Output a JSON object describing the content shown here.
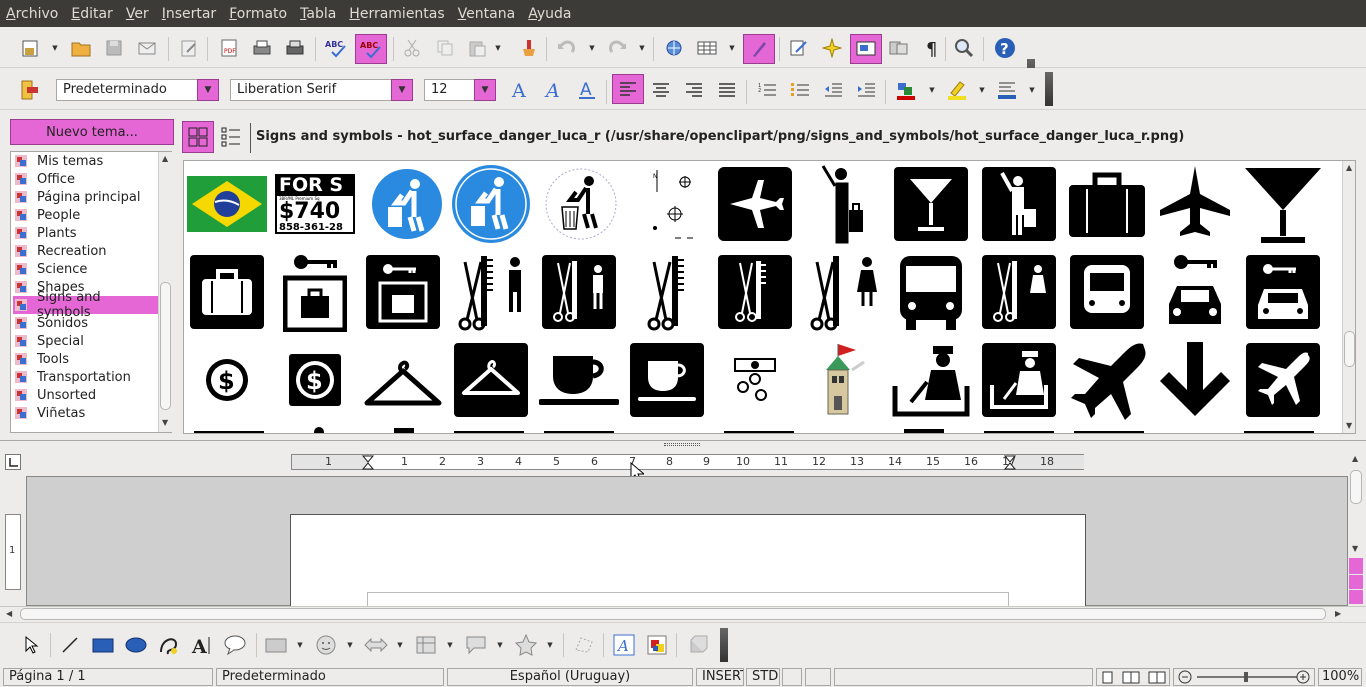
{
  "menu": [
    "Archivo",
    "Editar",
    "Ver",
    "Insertar",
    "Formato",
    "Tabla",
    "Herramientas",
    "Ventana",
    "Ayuda"
  ],
  "format": {
    "style": "Predeterminado",
    "font": "Liberation Serif",
    "size": "12"
  },
  "gallery": {
    "new_theme_label": "Nuevo tema...",
    "title": "Signs and symbols - hot_surface_danger_luca_r (/usr/share/openclipart/png/signs_and_symbols/hot_surface_danger_luca_r.png)",
    "themes": [
      "Mis temas",
      "Office",
      "Página principal",
      "People",
      "Plants",
      "Recreation",
      "Science",
      "Shapes",
      "Signs and symbols",
      "Sonidos",
      "Special",
      "Tools",
      "Transportation",
      "Unsorted",
      "Viñetas"
    ],
    "selected_theme": "Signs and symbols",
    "forsale_text_1": "FOR S",
    "forsale_text_2": "$740",
    "forsale_text_3": "858-361-28",
    "forsale_small": "3BR/ML Premium Sq"
  },
  "ruler": {
    "labels": [
      "1",
      "1",
      "2",
      "3",
      "4",
      "5",
      "6",
      "7",
      "8",
      "9",
      "10",
      "11",
      "12",
      "13",
      "14",
      "15",
      "16",
      "17",
      "18"
    ]
  },
  "vruler_label": "1",
  "status": {
    "page": "Página  1 / 1",
    "style": "Predeterminado",
    "language": "Español (Uruguay)",
    "insert": "INSERT",
    "std": "STD",
    "zoom": "100%"
  },
  "colors": {
    "accent": "#e567d6",
    "menubar": "#3c3b37",
    "background": "#edeceb"
  }
}
